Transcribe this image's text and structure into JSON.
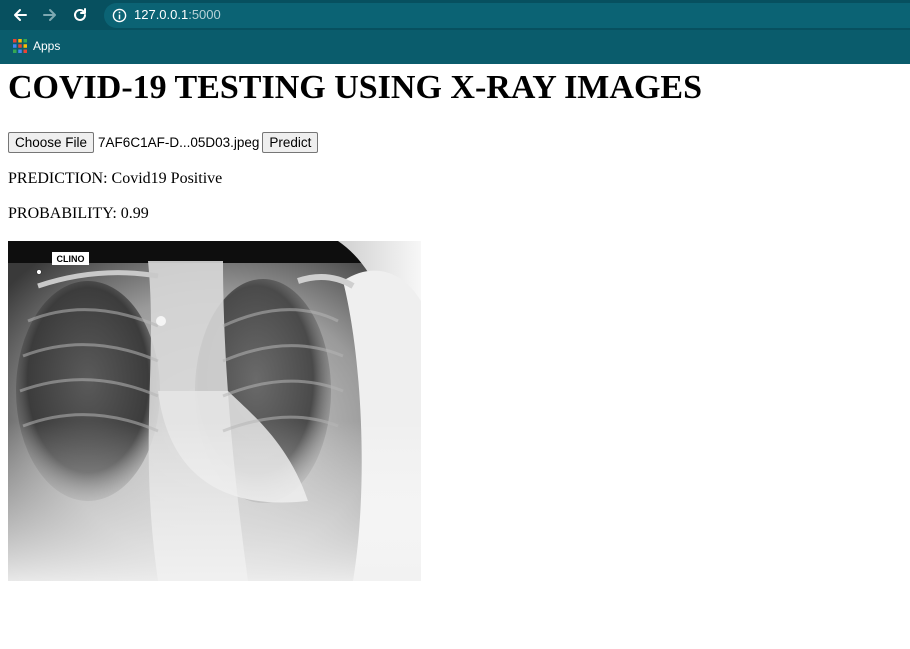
{
  "browser": {
    "url_host": "127.0.0.1",
    "url_port": ":5000",
    "bookmarks": [
      {
        "label": "Apps",
        "icon": "apps-grid-icon"
      }
    ],
    "nav_icons": [
      "back-arrow-icon",
      "forward-arrow-icon",
      "reload-icon",
      "info-icon"
    ]
  },
  "page": {
    "title": "COVID-19 TESTING USING X-RAY IMAGES",
    "form": {
      "choose_file_label": "Choose File",
      "file_name": "7AF6C1AF-D...05D03.jpeg",
      "predict_label": "Predict"
    },
    "prediction_text": "PREDICTION: Covid19 Positive",
    "probability_text": "PROBABILITY: 0.99",
    "image": {
      "marker_text": "CLINO"
    }
  },
  "colors": {
    "toolbar": "#07505f",
    "bookmark_bar": "#0a5c6c",
    "omnibox": "#0b6374"
  }
}
